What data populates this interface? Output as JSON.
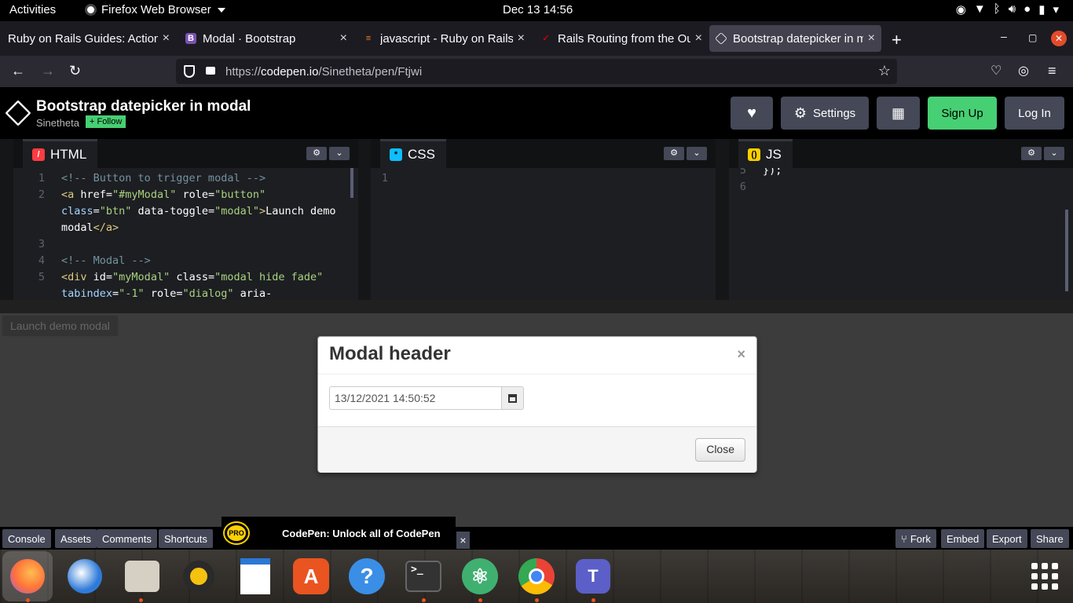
{
  "system": {
    "activities": "Activities",
    "app_name": "Firefox Web Browser",
    "clock": "Dec 13  14:56"
  },
  "tabs": [
    {
      "title": "Ruby on Rails Guides: Action",
      "favicon": "rails-guides",
      "active": false
    },
    {
      "title": "Modal · Bootstrap",
      "favicon": "B",
      "active": false
    },
    {
      "title": "javascript - Ruby on Rails:",
      "favicon": "stackoverflow",
      "active": false
    },
    {
      "title": "Rails Routing from the Ou",
      "favicon": "rails",
      "active": false
    },
    {
      "title": "Bootstrap datepicker in m",
      "favicon": "codepen",
      "active": true
    }
  ],
  "urlbar": {
    "scheme": "https://",
    "host": "codepen.io",
    "path": "/Sinetheta/pen/Ftjwi"
  },
  "codepen": {
    "title": "Bootstrap datepicker in modal",
    "user": "Sinetheta",
    "follow": "+ Follow",
    "settings": "Settings",
    "signup": "Sign Up",
    "login": "Log In",
    "accent": "#47cf73"
  },
  "editors": {
    "html": {
      "label": "HTML",
      "badge": "/",
      "lines": [
        {
          "num": "1",
          "code": "<!-- Button to trigger modal -->"
        },
        {
          "num": "2",
          "code": "<a href=\"#myModal\" role=\"button\""
        },
        {
          "num": "",
          "code": "class=\"btn\" data-toggle=\"modal\">Launch demo"
        },
        {
          "num": "",
          "code": "modal</a>"
        },
        {
          "num": "3",
          "code": ""
        },
        {
          "num": "4",
          "code": "<!-- Modal -->"
        },
        {
          "num": "5",
          "code": "<div id=\"myModal\" class=\"modal hide fade\""
        },
        {
          "num": "",
          "code": "tabindex=\"-1\" role=\"dialog\" aria-"
        }
      ]
    },
    "css": {
      "label": "CSS",
      "badge": "*",
      "lines": [
        {
          "num": "1",
          "code": ""
        }
      ]
    },
    "js": {
      "label": "JS",
      "badge": "()",
      "lines": [
        {
          "num": "5",
          "code": "});"
        },
        {
          "num": "6",
          "code": ""
        }
      ]
    }
  },
  "preview": {
    "launch_button": "Launch demo modal",
    "modal": {
      "title": "Modal header",
      "close_x": "×",
      "date_value": "13/12/2021 14:50:52",
      "close_button": "Close"
    }
  },
  "footer": {
    "left": [
      "Console",
      "Assets",
      "Comments",
      "Shortcuts"
    ],
    "promo_badge": "PRO",
    "promo_text": "CodePen: Unlock all of CodePen",
    "promo_close": "×",
    "right": [
      "Fork",
      "Embed",
      "Export",
      "Share"
    ]
  },
  "dock": [
    {
      "name": "firefox",
      "color": "#ff7139"
    },
    {
      "name": "thunderbird",
      "color": "#2f7bd9"
    },
    {
      "name": "files",
      "color": "#d6d0c4"
    },
    {
      "name": "rhythmbox",
      "color": "#f5c211"
    },
    {
      "name": "libreoffice-writer",
      "color": "#2a78d4"
    },
    {
      "name": "ubuntu-software",
      "color": "#e95420"
    },
    {
      "name": "help",
      "color": "#3a8ee6"
    },
    {
      "name": "terminal",
      "color": "#3a3a3a"
    },
    {
      "name": "atom",
      "color": "#40b070"
    },
    {
      "name": "chrome",
      "color": "#4285f4"
    },
    {
      "name": "teams",
      "color": "#5b5fc7"
    }
  ]
}
